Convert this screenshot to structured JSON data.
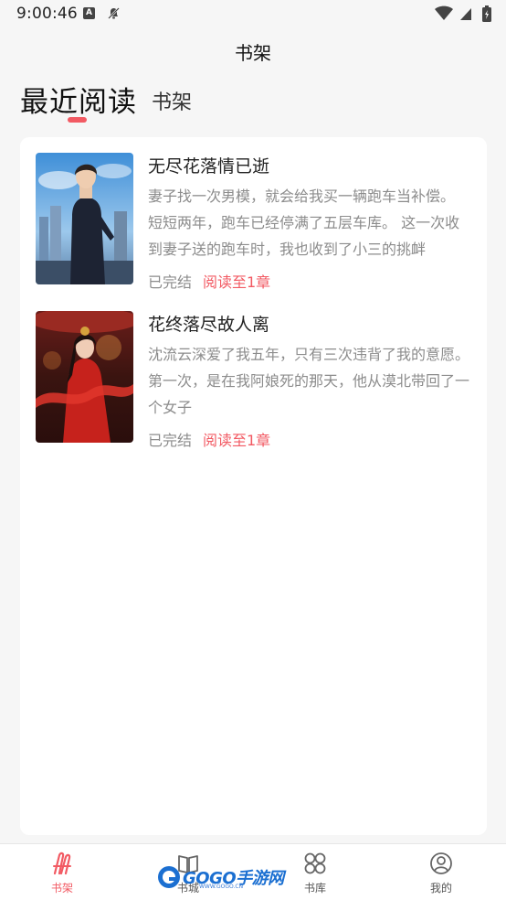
{
  "status_bar": {
    "time": "9:00:46",
    "icons": [
      "a-icon",
      "notification-off-icon",
      "wifi-icon",
      "signal-icon",
      "battery-icon"
    ]
  },
  "header": {
    "title": "书架"
  },
  "tabs": [
    {
      "label": "最近阅读",
      "active": true
    },
    {
      "label": "书架",
      "active": false
    }
  ],
  "books": [
    {
      "title": "无尽花落情已逝",
      "description": "妻子找一次男模，就会给我买一辆跑车当补偿。 短短两年，跑车已经停满了五层车库。 这一次收到妻子送的跑车时，我也收到了小三的挑衅",
      "status": "已完结",
      "progress": "阅读至1章"
    },
    {
      "title": "花终落尽故人离",
      "description": "沈流云深爱了我五年，只有三次违背了我的意愿。 第一次，是在我阿娘死的那天，他从漠北带回了一个女子",
      "status": "已完结",
      "progress": "阅读至1章"
    }
  ],
  "bottom_nav": [
    {
      "label": "书架",
      "icon": "bookshelf-icon",
      "active": true
    },
    {
      "label": "书城",
      "icon": "book-open-icon",
      "active": false
    },
    {
      "label": "书库",
      "icon": "grid-icon",
      "active": false
    },
    {
      "label": "我的",
      "icon": "user-icon",
      "active": false
    }
  ],
  "watermark": {
    "text": "GOGO手游网",
    "sub": "WWW.GOGO.CN"
  },
  "colors": {
    "accent": "#f25a63",
    "background": "#f6f6f6",
    "card": "#ffffff",
    "muted_text": "#8c8c8c"
  }
}
